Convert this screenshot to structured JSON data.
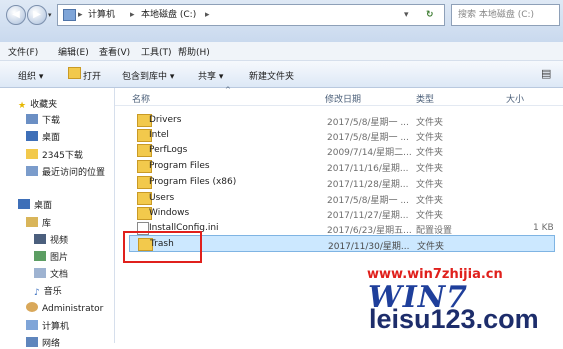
{
  "address_bar": {
    "path": [
      "计算机",
      "本地磁盘 (C:)"
    ],
    "search_placeholder": "搜索 本地磁盘 (C:)"
  },
  "menu": [
    "文件(F)",
    "编辑(E)",
    "查看(V)",
    "工具(T)",
    "帮助(H)"
  ],
  "toolbar": {
    "organize": "组织 ▾",
    "open": "打开",
    "include": "包含到库中 ▾",
    "share": "共享 ▾",
    "new_folder": "新建文件夹"
  },
  "nav": {
    "favorites": "收藏夹",
    "downloads": "下载",
    "desktop": "桌面",
    "d2345": "2345下载",
    "recent": "最近访问的位置",
    "desktop_root": "桌面",
    "libraries": "库",
    "videos": "视频",
    "pictures": "图片",
    "documents": "文档",
    "music": "音乐",
    "admin": "Administrator",
    "computer": "计算机",
    "network": "网络"
  },
  "columns": {
    "name": "名称",
    "date": "修改日期",
    "type": "类型",
    "size": "大小"
  },
  "files": [
    {
      "name": "Drivers",
      "date": "2017/5/8/星期一 ...",
      "type": "文件夹",
      "size": ""
    },
    {
      "name": "Intel",
      "date": "2017/5/8/星期一 ...",
      "type": "文件夹",
      "size": ""
    },
    {
      "name": "PerfLogs",
      "date": "2009/7/14/星期二...",
      "type": "文件夹",
      "size": ""
    },
    {
      "name": "Program Files",
      "date": "2017/11/16/星期...",
      "type": "文件夹",
      "size": ""
    },
    {
      "name": "Program Files (x86)",
      "date": "2017/11/28/星期...",
      "type": "文件夹",
      "size": ""
    },
    {
      "name": "Users",
      "date": "2017/5/8/星期一 ...",
      "type": "文件夹",
      "size": ""
    },
    {
      "name": "Windows",
      "date": "2017/11/27/星期...",
      "type": "文件夹",
      "size": ""
    },
    {
      "name": "InstallConfig.ini",
      "date": "2017/6/23/星期五...",
      "type": "配置设置",
      "size": "1 KB"
    },
    {
      "name": "Trash",
      "date": "2017/11/30/星期...",
      "type": "文件夹",
      "size": ""
    }
  ],
  "watermark": {
    "url": "www.win7zhijia.cn",
    "logo": "WIN7",
    "site": "leisu123.com"
  },
  "colors": {
    "selection": "#cce8ff",
    "highlight_box": "#e0201c",
    "folder": "#f2c94c"
  }
}
